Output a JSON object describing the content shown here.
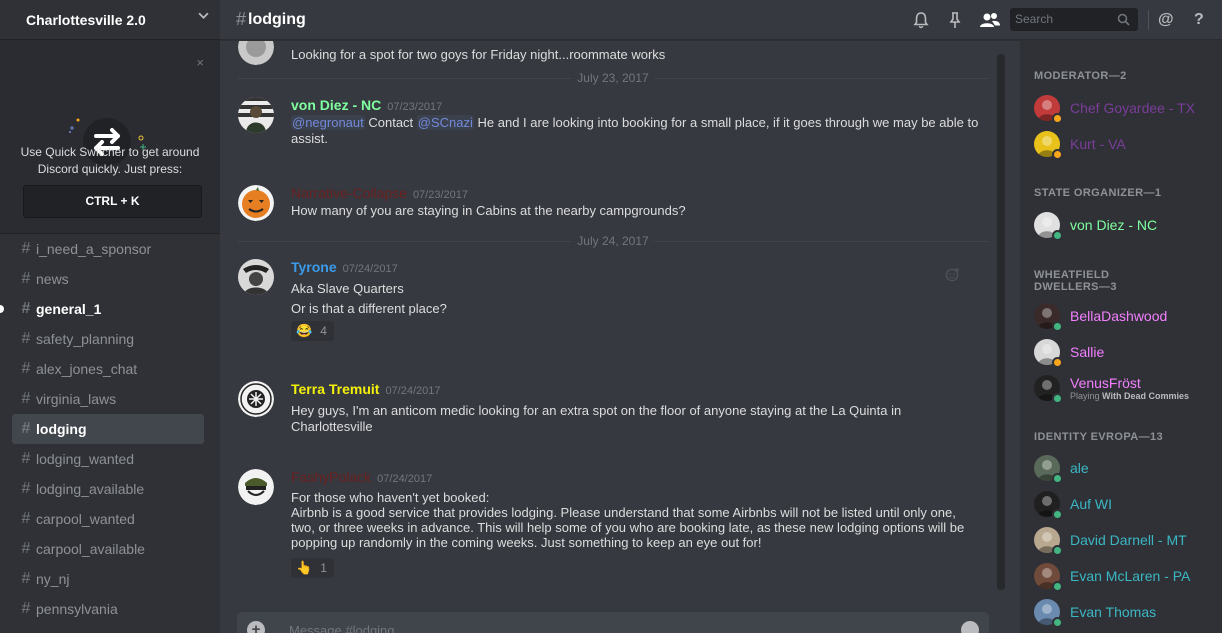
{
  "server": {
    "name": "Charlottesville 2.0"
  },
  "quick_switcher": {
    "close": "×",
    "text": "Use Quick Switcher to get around Discord quickly. Just press:",
    "shortcut": "CTRL + K"
  },
  "channels": [
    {
      "name": "i_need_a_sponsor",
      "state": "normal"
    },
    {
      "name": "news",
      "state": "normal"
    },
    {
      "name": "general_1",
      "state": "unread"
    },
    {
      "name": "safety_planning",
      "state": "normal"
    },
    {
      "name": "alex_jones_chat",
      "state": "normal"
    },
    {
      "name": "virginia_laws",
      "state": "normal"
    },
    {
      "name": "lodging",
      "state": "active"
    },
    {
      "name": "lodging_wanted",
      "state": "normal"
    },
    {
      "name": "lodging_available",
      "state": "normal"
    },
    {
      "name": "carpool_wanted",
      "state": "normal"
    },
    {
      "name": "carpool_available",
      "state": "normal"
    },
    {
      "name": "ny_nj",
      "state": "normal"
    },
    {
      "name": "pennsylvania",
      "state": "normal"
    }
  ],
  "chat": {
    "hash": "#",
    "channel": "lodging",
    "search_placeholder": "Search",
    "composer_placeholder": "Message #lodging",
    "composer_plus": "+"
  },
  "messages": {
    "partial_text": "Looking for a spot for two goys for Friday night...roommate works",
    "divider1": "July 23, 2017",
    "divider2": "July 24, 2017",
    "m1": {
      "user": "von Diez - NC",
      "ts": "07/23/2017",
      "mention1": "@negronaut",
      "mid": " Contact ",
      "mention2": "@SCnazi",
      "rest": "  He and I are looking into booking for a small place, if it goes through we may be able to assist.",
      "color": "#7fffa0"
    },
    "m2": {
      "user": "Narrative-Collapse",
      "ts": "07/23/2017",
      "text": "How many of you are staying in Cabins at the nearby campgrounds?",
      "color": "#5c1a1a"
    },
    "m3": {
      "user": "Tyrone",
      "ts": "07/24/2017",
      "line1": "Aka Slave Quarters",
      "line2": "Or is that a different place?",
      "reaction_emoji": "😂",
      "reaction_count": "4",
      "color": "#3b9bea"
    },
    "m4": {
      "user": "Terra Tremuit",
      "ts": "07/24/2017",
      "text": "Hey guys, I'm an anticom medic looking for an extra spot on the floor of anyone staying at the La Quinta in Charlottesville",
      "color": "#f5f10a"
    },
    "m5": {
      "user": "FashyPolack",
      "ts": "07/24/2017",
      "line1": "For those who haven't yet booked:",
      "line2": "Airbnb is a good service that provides lodging. Please understand that some Airbnbs will not be listed until only one, two, or three weeks in advance. This will help some of you who are booking late, as these new lodging options will be popping up randomly in the coming weeks. Just something to keep an eye out for!",
      "reaction_emoji": "👆",
      "reaction_count": "1",
      "color": "#5c1a1a"
    }
  },
  "members": {
    "groups": [
      {
        "title": "MODERATOR—2"
      },
      {
        "title": "STATE ORGANIZER—1"
      },
      {
        "title": "WHEATFIELD DWELLERS—3"
      },
      {
        "title": "IDENTITY EVROPA—13"
      }
    ],
    "list": [
      {
        "name": "Chef Goyardee - TX",
        "color": "#7a3d9a",
        "status": "#faa61a"
      },
      {
        "name": "Kurt - VA",
        "color": "#7a3d9a",
        "status": "#faa61a"
      },
      {
        "name": "von Diez - NC",
        "color": "#7fffa0",
        "status": "#43b581"
      },
      {
        "name": "BellaDashwood",
        "color": "#f47fff",
        "status": "#43b581"
      },
      {
        "name": "Sallie",
        "color": "#f47fff",
        "status": "#faa61a"
      },
      {
        "name": "VenusFröst",
        "color": "#f47fff",
        "status": "#43b581",
        "activity_prefix": "Playing ",
        "activity": "With Dead Commies"
      },
      {
        "name": "ale",
        "color": "#3bb7c4",
        "status": "#43b581"
      },
      {
        "name": "Auf WI",
        "color": "#3bb7c4",
        "status": "#43b581"
      },
      {
        "name": "David Darnell - MT",
        "color": "#3bb7c4",
        "status": "#43b581"
      },
      {
        "name": "Evan McLaren - PA",
        "color": "#3bb7c4",
        "status": "#43b581"
      },
      {
        "name": "Evan Thomas",
        "color": "#3bb7c4",
        "status": "#43b581"
      }
    ]
  },
  "icons": {
    "header": [
      "bell-icon",
      "pin-icon",
      "members-icon",
      "search-icon",
      "mention-icon",
      "help-icon"
    ]
  },
  "help_glyph": "?",
  "at_glyph": "@"
}
